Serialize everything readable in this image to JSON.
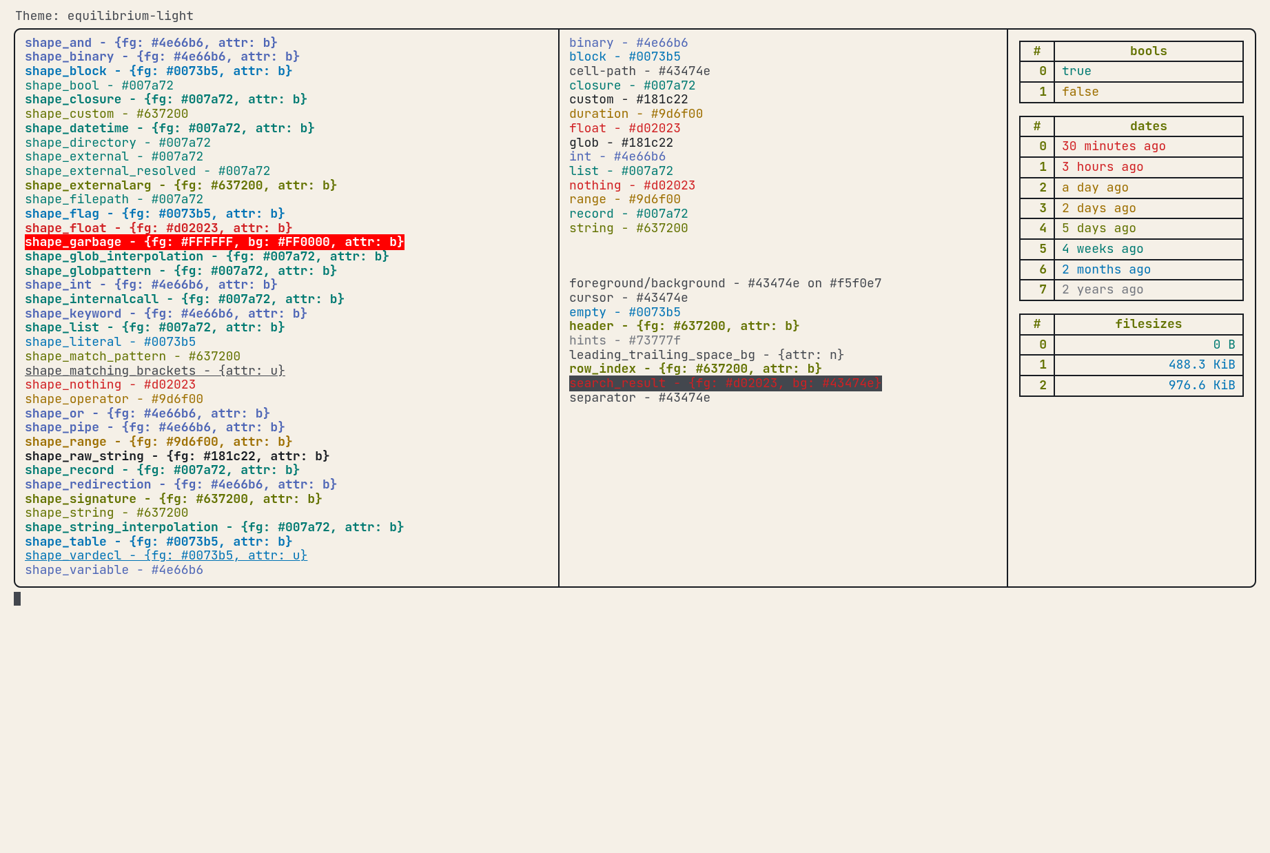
{
  "title": "Theme: equilibrium-light",
  "shapes": [
    {
      "text": "shape_and - {fg: #4e66b6, attr: b}",
      "c": "purple",
      "b": true
    },
    {
      "text": "shape_binary - {fg: #4e66b6, attr: b}",
      "c": "purple",
      "b": true
    },
    {
      "text": "shape_block - {fg: #0073b5, attr: b}",
      "c": "blue",
      "b": true
    },
    {
      "text": "shape_bool - #007a72",
      "c": "teal"
    },
    {
      "text": "shape_closure - {fg: #007a72, attr: b}",
      "c": "teal",
      "b": true
    },
    {
      "text": "shape_custom - #637200",
      "c": "olive"
    },
    {
      "text": "shape_datetime - {fg: #007a72, attr: b}",
      "c": "teal",
      "b": true
    },
    {
      "text": "shape_directory - #007a72",
      "c": "teal"
    },
    {
      "text": "shape_external - #007a72",
      "c": "teal"
    },
    {
      "text": "shape_external_resolved - #007a72",
      "c": "teal"
    },
    {
      "text": "shape_externalarg - {fg: #637200, attr: b}",
      "c": "olive",
      "b": true
    },
    {
      "text": "shape_filepath - #007a72",
      "c": "teal"
    },
    {
      "text": "shape_flag - {fg: #0073b5, attr: b}",
      "c": "blue",
      "b": true
    },
    {
      "text": "shape_float - {fg: #d02023, attr: b}",
      "c": "red",
      "b": true
    },
    {
      "text": "shape_garbage - {fg: #FFFFFF, bg: #FF0000, attr: b}",
      "c": "white",
      "b": true,
      "bg": "red"
    },
    {
      "text": "shape_glob_interpolation - {fg: #007a72, attr: b}",
      "c": "teal",
      "b": true
    },
    {
      "text": "shape_globpattern - {fg: #007a72, attr: b}",
      "c": "teal",
      "b": true
    },
    {
      "text": "shape_int - {fg: #4e66b6, attr: b}",
      "c": "purple",
      "b": true
    },
    {
      "text": "shape_internalcall - {fg: #007a72, attr: b}",
      "c": "teal",
      "b": true
    },
    {
      "text": "shape_keyword - {fg: #4e66b6, attr: b}",
      "c": "purple",
      "b": true
    },
    {
      "text": "shape_list - {fg: #007a72, attr: b}",
      "c": "teal",
      "b": true
    },
    {
      "text": "shape_literal - #0073b5",
      "c": "blue"
    },
    {
      "text": "shape_match_pattern - #637200",
      "c": "olive"
    },
    {
      "text": "shape_matching_brackets - {attr: u}",
      "c": "fg",
      "u": true
    },
    {
      "text": "shape_nothing - #d02023",
      "c": "red"
    },
    {
      "text": "shape_operator - #9d6f00",
      "c": "gold"
    },
    {
      "text": "shape_or - {fg: #4e66b6, attr: b}",
      "c": "purple",
      "b": true
    },
    {
      "text": "shape_pipe - {fg: #4e66b6, attr: b}",
      "c": "purple",
      "b": true
    },
    {
      "text": "shape_range - {fg: #9d6f00, attr: b}",
      "c": "gold",
      "b": true
    },
    {
      "text": "shape_raw_string - {fg: #181c22, attr: b}",
      "c": "black",
      "b": true
    },
    {
      "text": "shape_record - {fg: #007a72, attr: b}",
      "c": "teal",
      "b": true
    },
    {
      "text": "shape_redirection - {fg: #4e66b6, attr: b}",
      "c": "purple",
      "b": true
    },
    {
      "text": "shape_signature - {fg: #637200, attr: b}",
      "c": "olive",
      "b": true
    },
    {
      "text": "shape_string - #637200",
      "c": "olive"
    },
    {
      "text": "shape_string_interpolation - {fg: #007a72, attr: b}",
      "c": "teal",
      "b": true
    },
    {
      "text": "shape_table - {fg: #0073b5, attr: b}",
      "c": "blue",
      "b": true
    },
    {
      "text": "shape_vardecl - {fg: #0073b5, attr: u}",
      "c": "blue",
      "u": true
    },
    {
      "text": "shape_variable - #4e66b6",
      "c": "purple"
    }
  ],
  "types": [
    {
      "text": "binary - #4e66b6",
      "c": "purple"
    },
    {
      "text": "block - #0073b5",
      "c": "blue"
    },
    {
      "text": "cell-path - #43474e",
      "c": "fg"
    },
    {
      "text": "closure - #007a72",
      "c": "teal"
    },
    {
      "text": "custom - #181c22",
      "c": "black"
    },
    {
      "text": "duration - #9d6f00",
      "c": "gold"
    },
    {
      "text": "float - #d02023",
      "c": "red"
    },
    {
      "text": "glob - #181c22",
      "c": "black"
    },
    {
      "text": "int - #4e66b6",
      "c": "purple"
    },
    {
      "text": "list - #007a72",
      "c": "teal"
    },
    {
      "text": "nothing - #d02023",
      "c": "red"
    },
    {
      "text": "range - #9d6f00",
      "c": "gold"
    },
    {
      "text": "record - #007a72",
      "c": "teal"
    },
    {
      "text": "string - #637200",
      "c": "olive"
    }
  ],
  "misc": [
    {
      "text": "foreground/background - #43474e on #f5f0e7",
      "c": "fg"
    },
    {
      "text": "cursor - #43474e",
      "c": "fg"
    },
    {
      "text": "empty - #0073b5",
      "c": "blue"
    },
    {
      "text": "header - {fg: #637200, attr: b}",
      "c": "olive",
      "b": true
    },
    {
      "text": "hints - #73777f",
      "c": "gray"
    },
    {
      "text": "leading_trailing_space_bg - {attr: n}",
      "c": "fg"
    },
    {
      "text": "row_index - {fg: #637200, attr: b}",
      "c": "olive",
      "b": true
    },
    {
      "text": "search_result - {fg: #d02023, bg: #43474e}",
      "c": "red",
      "bg": "dark"
    },
    {
      "text": "separator - #43474e",
      "c": "fg"
    }
  ],
  "tables": {
    "bools": {
      "header": "bools",
      "rows": [
        {
          "i": "0",
          "v": "true",
          "c": "teal"
        },
        {
          "i": "1",
          "v": "false",
          "c": "gold"
        }
      ]
    },
    "dates": {
      "header": "dates",
      "rows": [
        {
          "i": "0",
          "v": "30 minutes ago",
          "c": "red",
          "b": true
        },
        {
          "i": "1",
          "v": "3 hours ago",
          "c": "red"
        },
        {
          "i": "2",
          "v": "a day ago",
          "c": "gold"
        },
        {
          "i": "3",
          "v": "2 days ago",
          "c": "gold"
        },
        {
          "i": "4",
          "v": "5 days ago",
          "c": "olive",
          "b": true
        },
        {
          "i": "5",
          "v": "4 weeks ago",
          "c": "teal"
        },
        {
          "i": "6",
          "v": "2 months ago",
          "c": "blue"
        },
        {
          "i": "7",
          "v": "2 years ago",
          "c": "gray"
        }
      ]
    },
    "filesizes": {
      "header": "filesizes",
      "rows": [
        {
          "i": "0",
          "v": "0 B",
          "c": "teal"
        },
        {
          "i": "1",
          "v": "488.3 KiB",
          "c": "blue"
        },
        {
          "i": "2",
          "v": "976.6 KiB",
          "c": "blue"
        }
      ]
    }
  },
  "idx_label": "#"
}
